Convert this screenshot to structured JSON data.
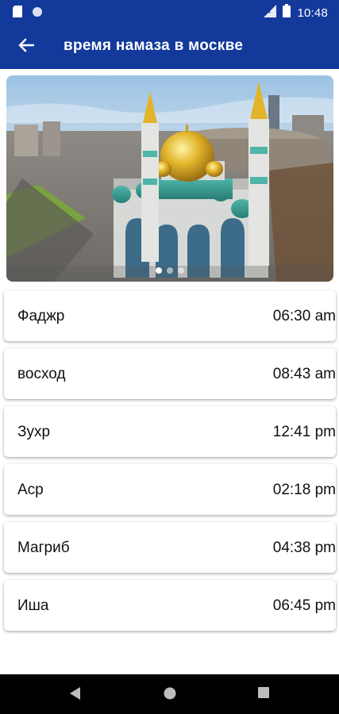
{
  "status_bar": {
    "time": "10:48"
  },
  "app_bar": {
    "title": "время намаза в москве",
    "back_icon": "arrow-left-icon"
  },
  "colors": {
    "primary": "#13399b",
    "card_bg": "#ffffff",
    "text": "#111111"
  },
  "slider": {
    "slide_count": 3,
    "active_index": 0
  },
  "prayers": [
    {
      "name": "Фаджр",
      "time": "06:30 am"
    },
    {
      "name": "восход",
      "time": "08:43 am"
    },
    {
      "name": "Зухр",
      "time": "12:41 pm"
    },
    {
      "name": "Аср",
      "time": "02:18 pm"
    },
    {
      "name": "Магриб",
      "time": "04:38 pm"
    },
    {
      "name": "Иша",
      "time": "06:45 pm"
    }
  ]
}
